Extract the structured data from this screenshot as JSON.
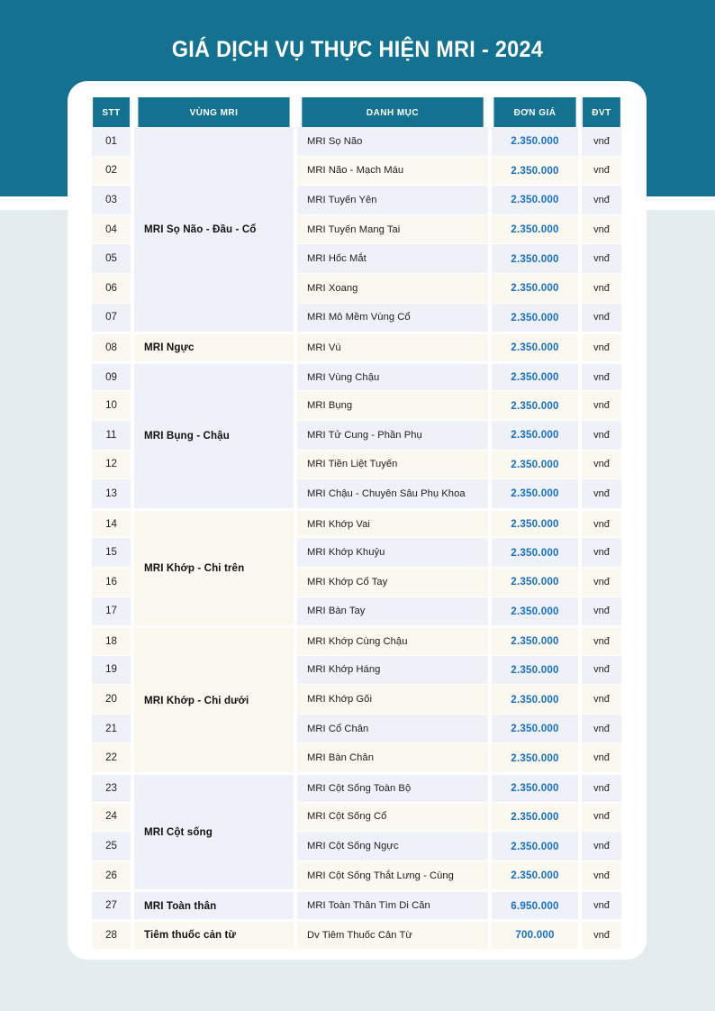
{
  "banner": {
    "title": "GIÁ DỊCH VỤ THỰC HIỆN MRI - 2024",
    "color": "#14718f"
  },
  "page": {
    "background_color": "#e3edf0",
    "card_color": "#ffffff"
  },
  "table": {
    "accent_color": "#14718f",
    "price_color": "#1a6fc4",
    "row_tint_blue": "#eef2f8",
    "row_tint_cream": "#faf8ef",
    "columns": [
      "STT",
      "VÙNG MRI",
      "DANH MỤC",
      "ĐƠN GIÁ",
      "ĐVT"
    ],
    "rows": [
      {
        "stt": "01",
        "vung": "",
        "danh": "MRI Sọ Não",
        "gia": "2.350.000",
        "dvt": "vnđ",
        "group_start": true
      },
      {
        "stt": "02",
        "vung": "",
        "danh": "MRI Não - Mạch Máu",
        "gia": "2.350.000",
        "dvt": "vnđ",
        "group_start": false
      },
      {
        "stt": "03",
        "vung": "",
        "danh": "MRI Tuyến Yên",
        "gia": "2.350.000",
        "dvt": "vnđ",
        "group_start": false
      },
      {
        "stt": "04",
        "vung": "MRI Sọ Não - Đầu - Cổ",
        "danh": "MRI Tuyến Mang Tai",
        "gia": "2.350.000",
        "dvt": "vnđ",
        "group_start": false
      },
      {
        "stt": "05",
        "vung": "",
        "danh": "MRI Hốc Mắt",
        "gia": "2.350.000",
        "dvt": "vnđ",
        "group_start": false
      },
      {
        "stt": "06",
        "vung": "",
        "danh": "MRI Xoang",
        "gia": "2.350.000",
        "dvt": "vnđ",
        "group_start": false
      },
      {
        "stt": "07",
        "vung": "",
        "danh": "MRI Mô Mềm Vùng Cổ",
        "gia": "2.350.000",
        "dvt": "vnđ",
        "group_start": false
      },
      {
        "stt": "08",
        "vung": "MRI Ngực",
        "danh": "MRI Vú",
        "gia": "2.350.000",
        "dvt": "vnđ",
        "group_start": true
      },
      {
        "stt": "09",
        "vung": "",
        "danh": "MRI Vùng Chậu",
        "gia": "2.350.000",
        "dvt": "vnđ",
        "group_start": true
      },
      {
        "stt": "10",
        "vung": "",
        "danh": "MRI Bụng",
        "gia": "2.350.000",
        "dvt": "vnđ",
        "group_start": false
      },
      {
        "stt": "11",
        "vung": "MRI Bụng - Chậu",
        "danh": "MRI Tử Cung  - Phần Phụ",
        "gia": "2.350.000",
        "dvt": "vnđ",
        "group_start": false
      },
      {
        "stt": "12",
        "vung": "",
        "danh": "MRI Tiền Liệt Tuyến",
        "gia": "2.350.000",
        "dvt": "vnđ",
        "group_start": false
      },
      {
        "stt": "13",
        "vung": "",
        "danh": "MRI Chậu - Chuyên Sâu Phụ Khoa",
        "gia": "2.350.000",
        "dvt": "vnđ",
        "group_start": false
      },
      {
        "stt": "14",
        "vung": "",
        "danh": "MRI Khớp Vai",
        "gia": "2.350.000",
        "dvt": "vnđ",
        "group_start": true
      },
      {
        "stt": "15",
        "vung": "",
        "danh": "MRI Khớp Khuỷu",
        "gia": "2.350.000",
        "dvt": "vnđ",
        "group_start": false
      },
      {
        "stt": "16",
        "vung": "MRI Khớp - Chi trên",
        "danh": "MRI Khớp Cổ Tay",
        "gia": "2.350.000",
        "dvt": "vnđ",
        "group_start": false
      },
      {
        "stt": "17",
        "vung": "",
        "danh": "MRI Bàn Tay",
        "gia": "2.350.000",
        "dvt": "vnđ",
        "group_start": false
      },
      {
        "stt": "18",
        "vung": "",
        "danh": "MRI Khớp Cùng Chậu",
        "gia": "2.350.000",
        "dvt": "vnđ",
        "group_start": true
      },
      {
        "stt": "19",
        "vung": "",
        "danh": "MRI Khớp Háng",
        "gia": "2.350.000",
        "dvt": "vnđ",
        "group_start": false
      },
      {
        "stt": "20",
        "vung": "MRI Khớp - Chi dưới",
        "danh": "MRI Khớp Gối",
        "gia": "2.350.000",
        "dvt": "vnđ",
        "group_start": false
      },
      {
        "stt": "21",
        "vung": "",
        "danh": "MRI Cổ Chân",
        "gia": "2.350.000",
        "dvt": "vnđ",
        "group_start": false
      },
      {
        "stt": "22",
        "vung": "",
        "danh": "MRI Bàn Chân",
        "gia": "2.350.000",
        "dvt": "vnđ",
        "group_start": false
      },
      {
        "stt": "23",
        "vung": "",
        "danh": "MRI Cột Sống Toàn Bộ",
        "gia": "2.350.000",
        "dvt": "vnđ",
        "group_start": true
      },
      {
        "stt": "24",
        "vung": "",
        "danh": "MRI Cột Sống Cổ",
        "gia": "2.350.000",
        "dvt": "vnđ",
        "group_start": false
      },
      {
        "stt": "25",
        "vung": "MRI Cột sống",
        "danh": "MRI Cột Sống Ngực",
        "gia": "2.350.000",
        "dvt": "vnđ",
        "group_start": false
      },
      {
        "stt": "26",
        "vung": "",
        "danh": "MRI Cột Sống Thắt Lưng - Cùng",
        "gia": "2.350.000",
        "dvt": "vnđ",
        "group_start": false
      },
      {
        "stt": "27",
        "vung": "MRI Toàn thân",
        "danh": "MRI Toàn Thân Tìm Di Căn",
        "gia": "6.950.000",
        "dvt": "vnđ",
        "group_start": true
      },
      {
        "stt": "28",
        "vung": "Tiêm thuốc cản từ",
        "danh": "Dv Tiêm Thuốc Cản Từ",
        "gia": "700.000",
        "dvt": "vnđ",
        "group_start": true
      }
    ]
  }
}
